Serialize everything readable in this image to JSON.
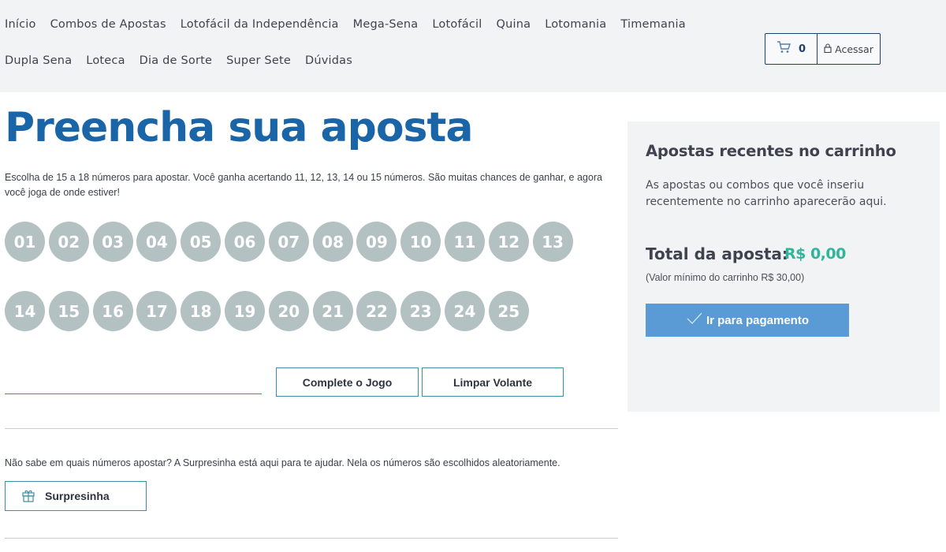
{
  "nav": {
    "row1": [
      "Início",
      "Combos de Apostas",
      "Lotofácil da Independência",
      "Mega-Sena",
      "Lotofácil",
      "Quina",
      "Lotomania",
      "Timemania"
    ],
    "row2": [
      "Dupla Sena",
      "Loteca",
      "Dia de Sorte",
      "Super Sete",
      "Dúvidas"
    ]
  },
  "account": {
    "cart_icon": "cart-icon",
    "cart_count": "0",
    "lock_icon": "lock-icon",
    "login_label": "Acessar"
  },
  "main": {
    "title": "Preencha sua aposta",
    "intro": "Escolha de 15 a 18 números para apostar. Você ganha acertando 11, 12, 13, 14 ou 15 números. São muitas chances de ganhar, e agora você joga de onde estiver!",
    "numbers": [
      "01",
      "02",
      "03",
      "04",
      "05",
      "06",
      "07",
      "08",
      "09",
      "10",
      "11",
      "12",
      "13",
      "14",
      "15",
      "16",
      "17",
      "18",
      "19",
      "20",
      "21",
      "22",
      "23",
      "24",
      "25"
    ],
    "number_input_value": "",
    "complete_label": "Complete o Jogo",
    "clear_label": "Limpar Volante",
    "surprise_text": "Não sabe em quais números apostar? A Surpresinha está aqui para te ajudar. Nela os números são escolhidos aleatoriamente.",
    "surprise_icon": "gift-icon",
    "surprise_label": "Surpresinha"
  },
  "sidebar": {
    "title": "Apostas recentes no carrinho",
    "text": "As apostas ou combos que você inseriu recentemente no carrinho aparecerão aqui.",
    "total_label": "Total da aposta:",
    "total_value": "R$ 0,00",
    "min_note": "(Valor mínimo do carrinho R$ 30,00)",
    "pay_icon": "check-icon",
    "pay_label": "Ir para pagamento"
  },
  "colors": {
    "title_blue": "#1a64a8",
    "ball_gray": "#b3c1c3",
    "accent_teal": "#3b8fa0",
    "total_green": "#2fb59a",
    "pay_blue": "#5b9bd5"
  }
}
